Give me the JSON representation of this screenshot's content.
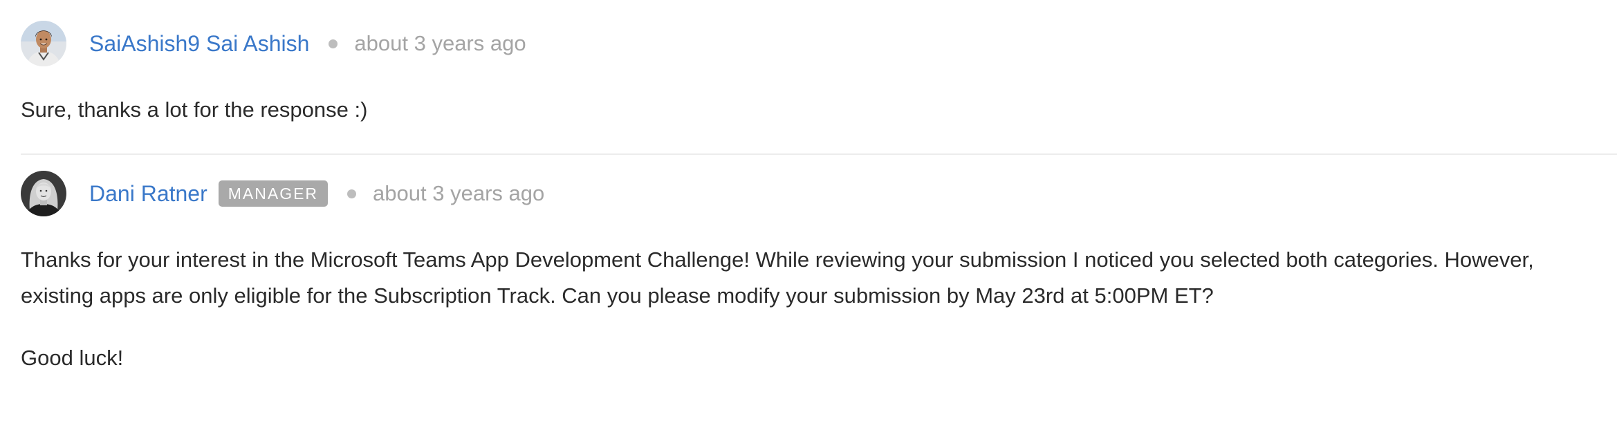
{
  "comments": [
    {
      "author": "SaiAshish9 Sai Ashish",
      "timestamp": "about 3 years ago",
      "body": [
        "Sure, thanks a lot for the response :)"
      ],
      "avatar_icon": "user-avatar-photo"
    },
    {
      "author": "Dani Ratner",
      "badge": "MANAGER",
      "timestamp": "about 3 years ago",
      "body": [
        "Thanks for your interest in the Microsoft Teams App Development Challenge! While reviewing your submission I noticed you selected both categories. However,",
        "existing apps are only eligible for the Subscription Track. Can you please modify your submission by May 23rd at 5:00PM ET?",
        "Good luck!"
      ],
      "avatar_icon": "user-avatar-photo"
    }
  ],
  "colors": {
    "author_link": "#3a78c9",
    "timestamp": "#a4a4a4",
    "badge_bg": "#a9a9a9",
    "divider": "#ececec"
  }
}
